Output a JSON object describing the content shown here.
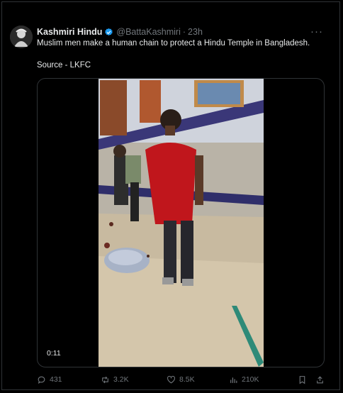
{
  "tweet": {
    "author_name": "Kashmiri Hindu",
    "handle": "@BattaKashmiri",
    "separator": "·",
    "time": "23h",
    "more_label": "···",
    "text": "Muslim men make a human chain to protect a Hindu Temple in Bangladesh.",
    "source_line": "Source - LKFC"
  },
  "media": {
    "duration": "0:11"
  },
  "actions": {
    "replies": "431",
    "retweets": "3.2K",
    "likes": "8.5K",
    "views": "210K"
  },
  "colors": {
    "background": "#000000",
    "text": "#e7e9ea",
    "muted": "#71767b",
    "border": "#2f3336",
    "verified": "#1d9bf0"
  },
  "icons": [
    "avatar",
    "verified-badge-icon",
    "more-icon",
    "reply-icon",
    "retweet-icon",
    "like-icon",
    "views-icon",
    "bookmark-icon",
    "share-icon"
  ]
}
